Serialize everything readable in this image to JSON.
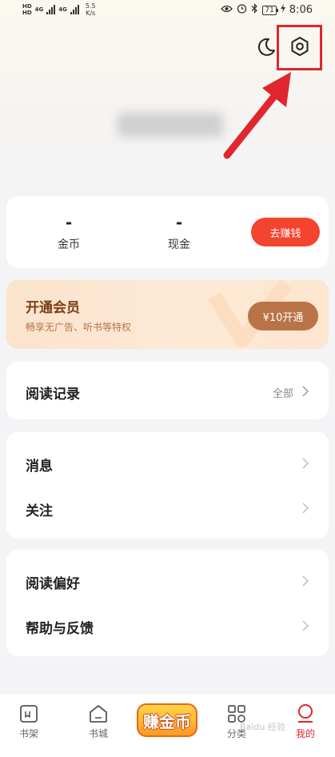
{
  "status_bar": {
    "hd1": "HD",
    "hd2": "HD",
    "net1": "4G",
    "net2": "4G",
    "speed_value": "5.5",
    "speed_unit": "K/s",
    "battery": "71",
    "time": "8:06"
  },
  "header": {
    "moon_icon": "moon-icon",
    "settings_icon": "gear-icon"
  },
  "wallet": {
    "coins_value": "-",
    "coins_label": "金币",
    "cash_value": "-",
    "cash_label": "现金",
    "earn_button": "去赚钱"
  },
  "vip": {
    "title": "开通会员",
    "subtitle": "畅享无广告、听书等特权",
    "button": "¥10开通"
  },
  "reading_history": {
    "title": "阅读记录",
    "all_label": "全部"
  },
  "menu_group_1": [
    {
      "label": "消息"
    },
    {
      "label": "关注"
    }
  ],
  "menu_group_2": [
    {
      "label": "阅读偏好"
    },
    {
      "label": "帮助与反馈"
    }
  ],
  "bottom_nav": {
    "bookshelf": "书架",
    "bookstore": "书城",
    "earn_coins": "赚金币",
    "category": "分类",
    "mine": "我的"
  },
  "watermark": "Baidu 经验",
  "colors": {
    "accent": "#f4432f",
    "vip_button": "#ba7347",
    "annotation": "#e0262e"
  }
}
